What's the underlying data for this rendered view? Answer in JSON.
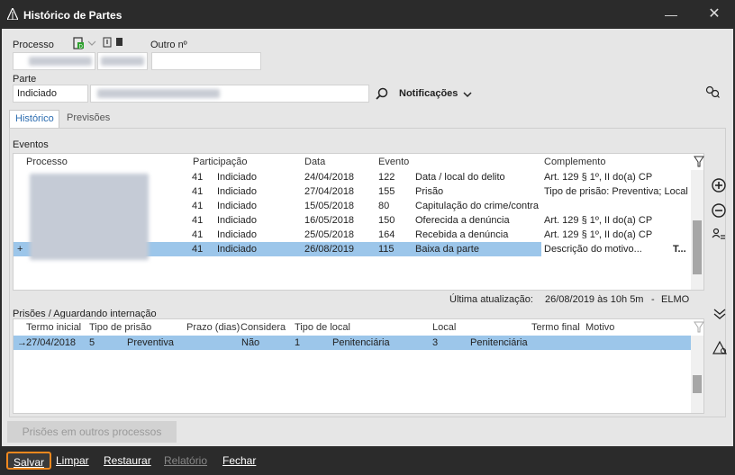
{
  "window": {
    "title": "Histórico de Partes"
  },
  "header": {
    "processo_label": "Processo",
    "outro_label": "Outro nº",
    "parte_label": "Parte",
    "parte_tipo": "Indiciado",
    "notificacoes_label": "Notificações"
  },
  "tabs": [
    {
      "label": "Histórico",
      "active": true
    },
    {
      "label": "Previsões",
      "active": false
    }
  ],
  "eventos": {
    "title": "Eventos",
    "columns": [
      "Processo",
      "Participação",
      "Data",
      "Evento",
      "Complemento"
    ],
    "rows": [
      {
        "num": "41",
        "part": "Indiciado",
        "data": "24/04/2018",
        "ev": "122",
        "desc": "Data / local do delito",
        "comp": "Art. 129 § 1º, II do(a) CP",
        "selected": false
      },
      {
        "num": "41",
        "part": "Indiciado",
        "data": "27/04/2018",
        "ev": "155",
        "desc": "Prisão",
        "comp": "Tipo de prisão: Preventiva; Local",
        "selected": false
      },
      {
        "num": "41",
        "part": "Indiciado",
        "data": "15/05/2018",
        "ev": "80",
        "desc": "Capitulação do crime/contra",
        "comp": "",
        "selected": false
      },
      {
        "num": "41",
        "part": "Indiciado",
        "data": "16/05/2018",
        "ev": "150",
        "desc": "Oferecida a denúncia",
        "comp": "Art. 129 § 1º, II do(a) CP",
        "selected": false
      },
      {
        "num": "41",
        "part": "Indiciado",
        "data": "25/05/2018",
        "ev": "164",
        "desc": "Recebida a denúncia",
        "comp": "Art. 129 § 1º, II do(a) CP",
        "selected": false
      },
      {
        "num": "41",
        "part": "Indiciado",
        "data": "26/08/2019",
        "ev": "115",
        "desc": "Baixa da parte",
        "comp": "Descrição do motivo...",
        "selected": true
      }
    ],
    "new_row_marker": "+",
    "text_tool": "T..."
  },
  "ultima": {
    "label": "Última atualização:",
    "value": "26/08/2019 às 10h 5m",
    "sep": "-",
    "user": "ELMO"
  },
  "prisoes": {
    "title": "Prisões / Aguardando internação",
    "columns": [
      "Termo inicial",
      "Tipo de prisão",
      "Prazo (dias)",
      "Considera",
      "Tipo de local",
      "Local",
      "Termo final",
      "Motivo"
    ],
    "rows": [
      {
        "marker": "→",
        "termo": "27/04/2018",
        "tipo_cod": "5",
        "tipo": "Preventiva",
        "prazo": "",
        "considera": "Não",
        "tlocal_cod": "1",
        "tlocal": "Penitenciária",
        "local_cod": "3",
        "local": "Penitenciária",
        "selected": true
      }
    ]
  },
  "actions": {
    "outros": "Prisões em outros processos",
    "salvar": "Salvar",
    "limpar": "Limpar",
    "restaurar": "Restaurar",
    "relatorio": "Relatório",
    "fechar": "Fechar"
  },
  "colors": {
    "selected_row": "#9cc6ea",
    "focus_ring": "#f0881e",
    "titlebar": "#2b2b2b",
    "tab_active_text": "#2b6cb0"
  },
  "icons": [
    "app-icon",
    "minimize-icon",
    "close-icon",
    "new-document-icon",
    "chevron-down-icon",
    "notes-icon",
    "search-icon",
    "people-search-icon",
    "filter-icon",
    "add-circle-icon",
    "remove-circle-icon",
    "user-list-icon",
    "double-chevron-down-icon",
    "scales-icon"
  ]
}
